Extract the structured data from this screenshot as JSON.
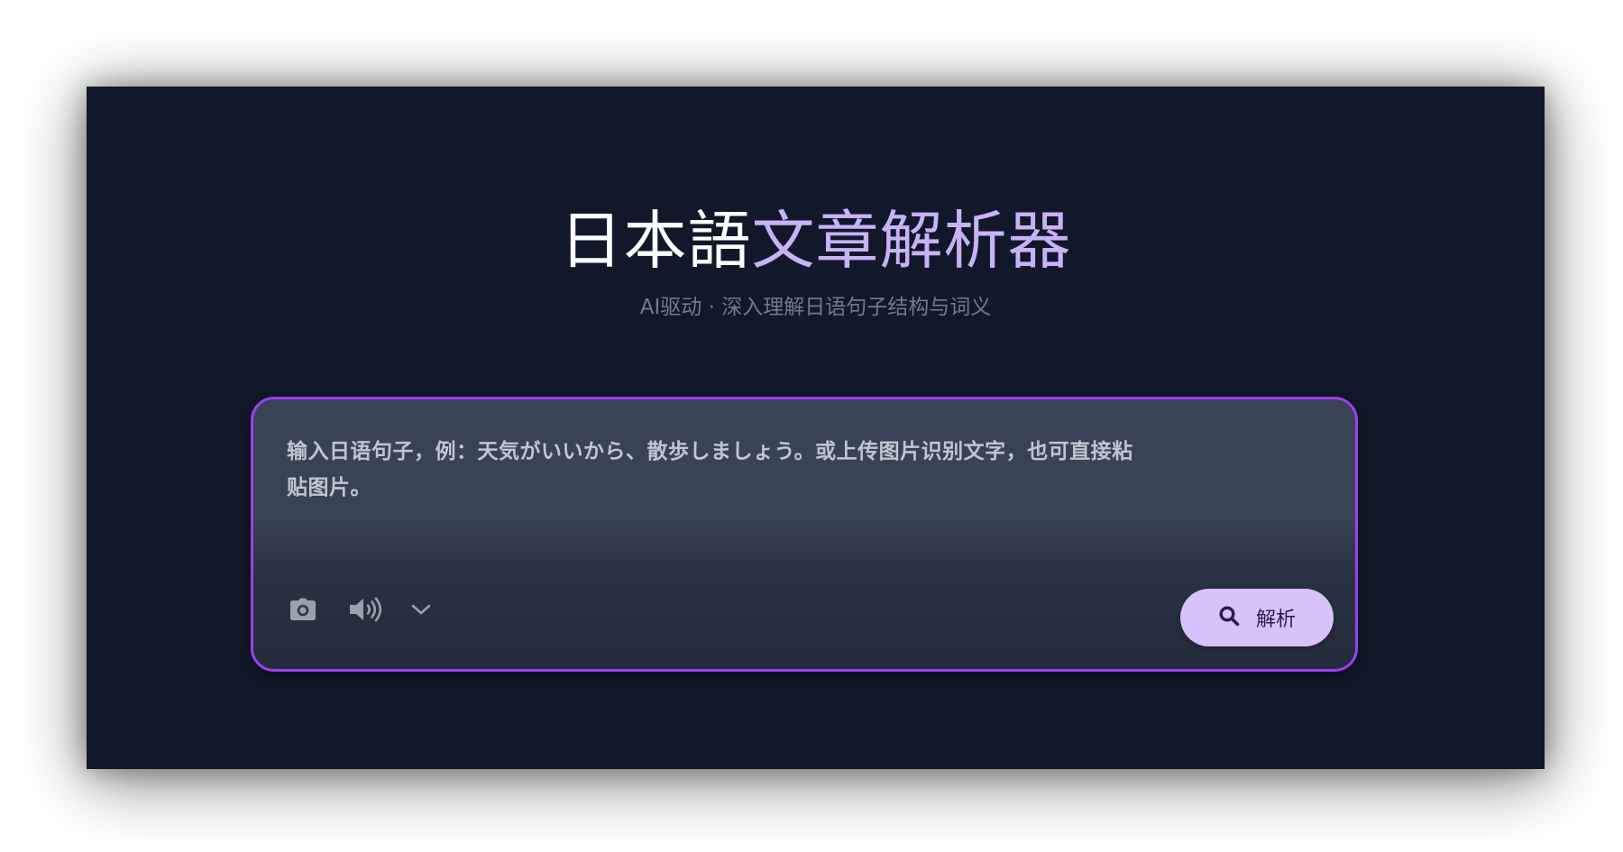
{
  "header": {
    "title_part1": "日本語",
    "title_part2": "文章解析器",
    "subtitle": "AI驱动 · 深入理解日语句子结构与词义"
  },
  "input": {
    "placeholder": "输入日语句子，例：天気がいいから、散歩しましょう。或上传图片识别文字，也可直接粘贴图片。",
    "value": ""
  },
  "toolbar": {
    "camera_icon": "camera-icon",
    "speaker_icon": "speaker-icon",
    "dropdown_icon": "chevron-down-icon"
  },
  "actions": {
    "analyze_label": "解析",
    "analyze_icon": "search-icon"
  },
  "colors": {
    "background": "#121829",
    "title_primary": "#ffffff",
    "title_accent": "#c8b2f7",
    "subtitle": "#727a8b",
    "input_border": "#9b3ff2",
    "input_bg": "#394356",
    "button_bg": "#d7c3f9",
    "button_text": "#2a1c4d",
    "icon": "#9aa1ad"
  }
}
